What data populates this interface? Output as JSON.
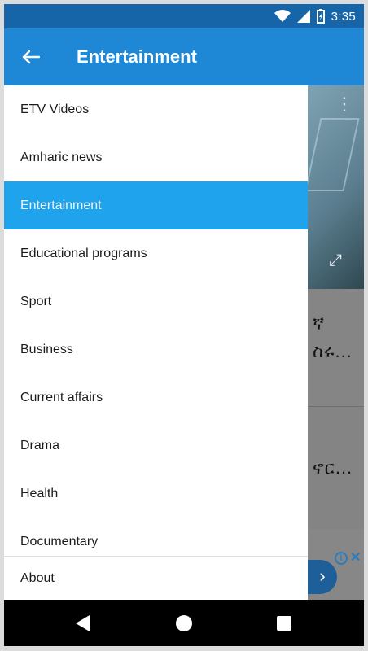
{
  "status_bar": {
    "time": "3:35",
    "icons": [
      "wifi-icon",
      "signal-icon",
      "battery-icon"
    ]
  },
  "app_bar": {
    "title": "Entertainment",
    "back_icon": "arrow-left-icon"
  },
  "drawer": {
    "items": [
      {
        "label": "ETV Videos",
        "selected": false
      },
      {
        "label": "Amharic news",
        "selected": false
      },
      {
        "label": "Entertainment",
        "selected": true
      },
      {
        "label": "Educational programs",
        "selected": false
      },
      {
        "label": "Sport",
        "selected": false
      },
      {
        "label": "Business",
        "selected": false
      },
      {
        "label": "Current affairs",
        "selected": false
      },
      {
        "label": "Drama",
        "selected": false
      },
      {
        "label": "Health",
        "selected": false
      },
      {
        "label": "Documentary",
        "selected": false
      }
    ],
    "footer_label": "About"
  },
  "background_content": {
    "card1_line1": "ኛ",
    "card1_line2": "ስሩ...",
    "card2_line1": "ኖር..."
  },
  "nav_bar": {
    "back_icon": "back-triangle-icon",
    "home_icon": "home-circle-icon",
    "recents_icon": "recents-square-icon"
  },
  "colors": {
    "status_bar": "#1565a8",
    "app_bar": "#1e88d6",
    "active_item": "#1fa3ec"
  }
}
